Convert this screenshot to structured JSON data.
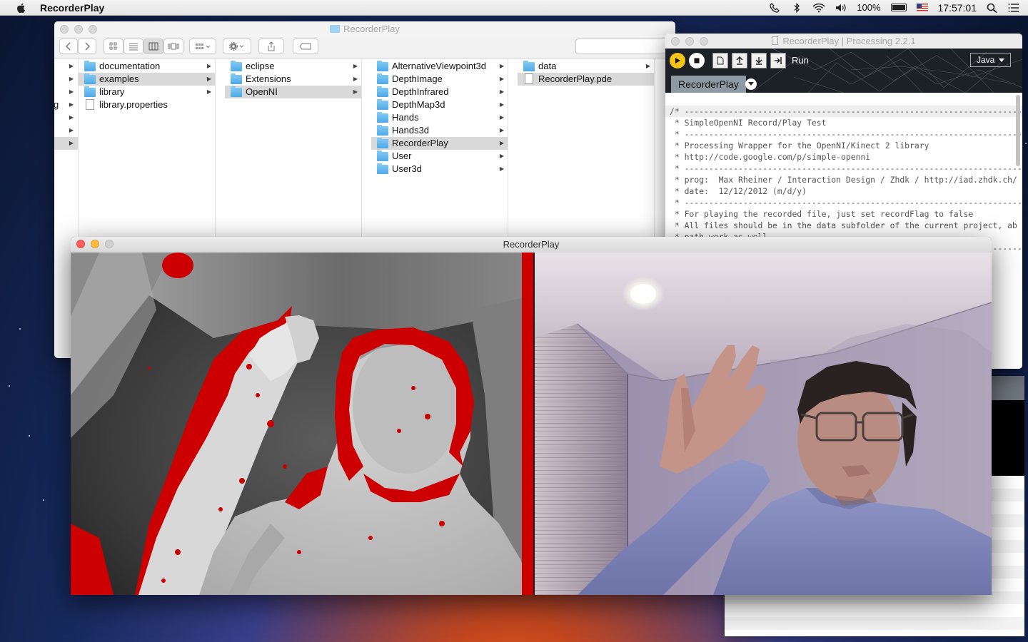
{
  "menubar": {
    "app_name": "RecorderPlay",
    "battery_percent": "100%",
    "clock": "17:57:01"
  },
  "finder": {
    "title": "RecorderPlay",
    "columns": [
      {
        "items": [
          {
            "name": "",
            "type": "folder",
            "selected": false
          },
          {
            "name": "",
            "type": "folder",
            "selected": false
          },
          {
            "name": "",
            "type": "folder",
            "selected": false
          },
          {
            "name": "g",
            "type": "folder",
            "selected": false
          },
          {
            "name": "",
            "type": "folder",
            "selected": false
          },
          {
            "name": "",
            "type": "folder",
            "selected": false
          },
          {
            "name": "",
            "type": "folder",
            "selected": true
          }
        ]
      },
      {
        "items": [
          {
            "name": "documentation",
            "type": "folder",
            "selected": false
          },
          {
            "name": "examples",
            "type": "folder",
            "selected": true
          },
          {
            "name": "library",
            "type": "folder",
            "selected": false
          },
          {
            "name": "library.properties",
            "type": "file",
            "selected": false
          }
        ]
      },
      {
        "items": [
          {
            "name": "eclipse",
            "type": "folder",
            "selected": false
          },
          {
            "name": "Extensions",
            "type": "folder",
            "selected": false
          },
          {
            "name": "OpenNI",
            "type": "folder",
            "selected": true
          }
        ]
      },
      {
        "items": [
          {
            "name": "AlternativeViewpoint3d",
            "type": "folder",
            "selected": false
          },
          {
            "name": "DepthImage",
            "type": "folder",
            "selected": false
          },
          {
            "name": "DepthInfrared",
            "type": "folder",
            "selected": false
          },
          {
            "name": "DepthMap3d",
            "type": "folder",
            "selected": false
          },
          {
            "name": "Hands",
            "type": "folder",
            "selected": false
          },
          {
            "name": "Hands3d",
            "type": "folder",
            "selected": false
          },
          {
            "name": "RecorderPlay",
            "type": "folder",
            "selected": true
          },
          {
            "name": "User",
            "type": "folder",
            "selected": false
          },
          {
            "name": "User3d",
            "type": "folder",
            "selected": false
          }
        ]
      },
      {
        "items": [
          {
            "name": "data",
            "type": "folder",
            "selected": false
          },
          {
            "name": "RecorderPlay.pde",
            "type": "file",
            "selected": true
          }
        ]
      }
    ]
  },
  "ide": {
    "title": "RecorderPlay | Processing 2.2.1",
    "run_label": "Run",
    "mode": "Java",
    "tab": "RecorderPlay",
    "code_lines": [
      "/* --------------------------------------------------------------------------",
      " * SimpleOpenNI Record/Play Test",
      " * --------------------------------------------------------------------------",
      " * Processing Wrapper for the OpenNI/Kinect 2 library",
      " * http://code.google.com/p/simple-openni",
      " * --------------------------------------------------------------------------",
      " * prog:  Max Rheiner / Interaction Design / Zhdk / http://iad.zhdk.ch/",
      " * date:  12/12/2012 (m/d/y)",
      " * --------------------------------------------------------------------------",
      " * For playing the recorded file, just set recordFlag to false",
      " * All files should be in the data subfolder of the current project, ab",
      " * path work as well",
      " * --------------------------------------------------------------------------"
    ]
  },
  "sketch": {
    "title": "RecorderPlay"
  },
  "colors": {
    "depth_highlight": "#cc0000",
    "run_button": "#f5c518",
    "close_red": "#fc605c",
    "minimize_yellow": "#fdbc40"
  }
}
